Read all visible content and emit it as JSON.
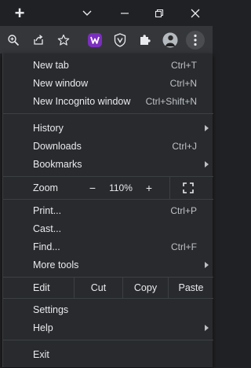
{
  "titlebar": {
    "new_tab_symbol": "+",
    "tab_search_icon": "chevron-down-icon",
    "minimize_icon": "minimize-icon",
    "restore_icon": "restore-icon",
    "close_icon": "close-icon"
  },
  "toolbar": {
    "icons": [
      "zoom-icon",
      "share-icon",
      "bookmark-star-icon",
      "extension-w-icon",
      "extension-shield-icon",
      "extensions-puzzle-icon",
      "profile-avatar",
      "menu-kebab-icon"
    ],
    "extension_w_color": "#7b2fbe"
  },
  "menu": {
    "group1": [
      {
        "label": "New tab",
        "shortcut": "Ctrl+T"
      },
      {
        "label": "New window",
        "shortcut": "Ctrl+N"
      },
      {
        "label": "New Incognito window",
        "shortcut": "Ctrl+Shift+N"
      }
    ],
    "group2": [
      {
        "label": "History",
        "submenu": true
      },
      {
        "label": "Downloads",
        "shortcut": "Ctrl+J"
      },
      {
        "label": "Bookmarks",
        "submenu": true
      }
    ],
    "zoom": {
      "label": "Zoom",
      "minus": "−",
      "value": "110%",
      "plus": "+"
    },
    "group3": [
      {
        "label": "Print...",
        "shortcut": "Ctrl+P"
      },
      {
        "label": "Cast..."
      },
      {
        "label": "Find...",
        "shortcut": "Ctrl+F"
      },
      {
        "label": "More tools",
        "submenu": true
      }
    ],
    "edit": {
      "label": "Edit",
      "cut": "Cut",
      "copy": "Copy",
      "paste": "Paste"
    },
    "group4": [
      {
        "label": "Settings"
      },
      {
        "label": "Help",
        "submenu": true
      }
    ],
    "exit": {
      "label": "Exit"
    }
  }
}
